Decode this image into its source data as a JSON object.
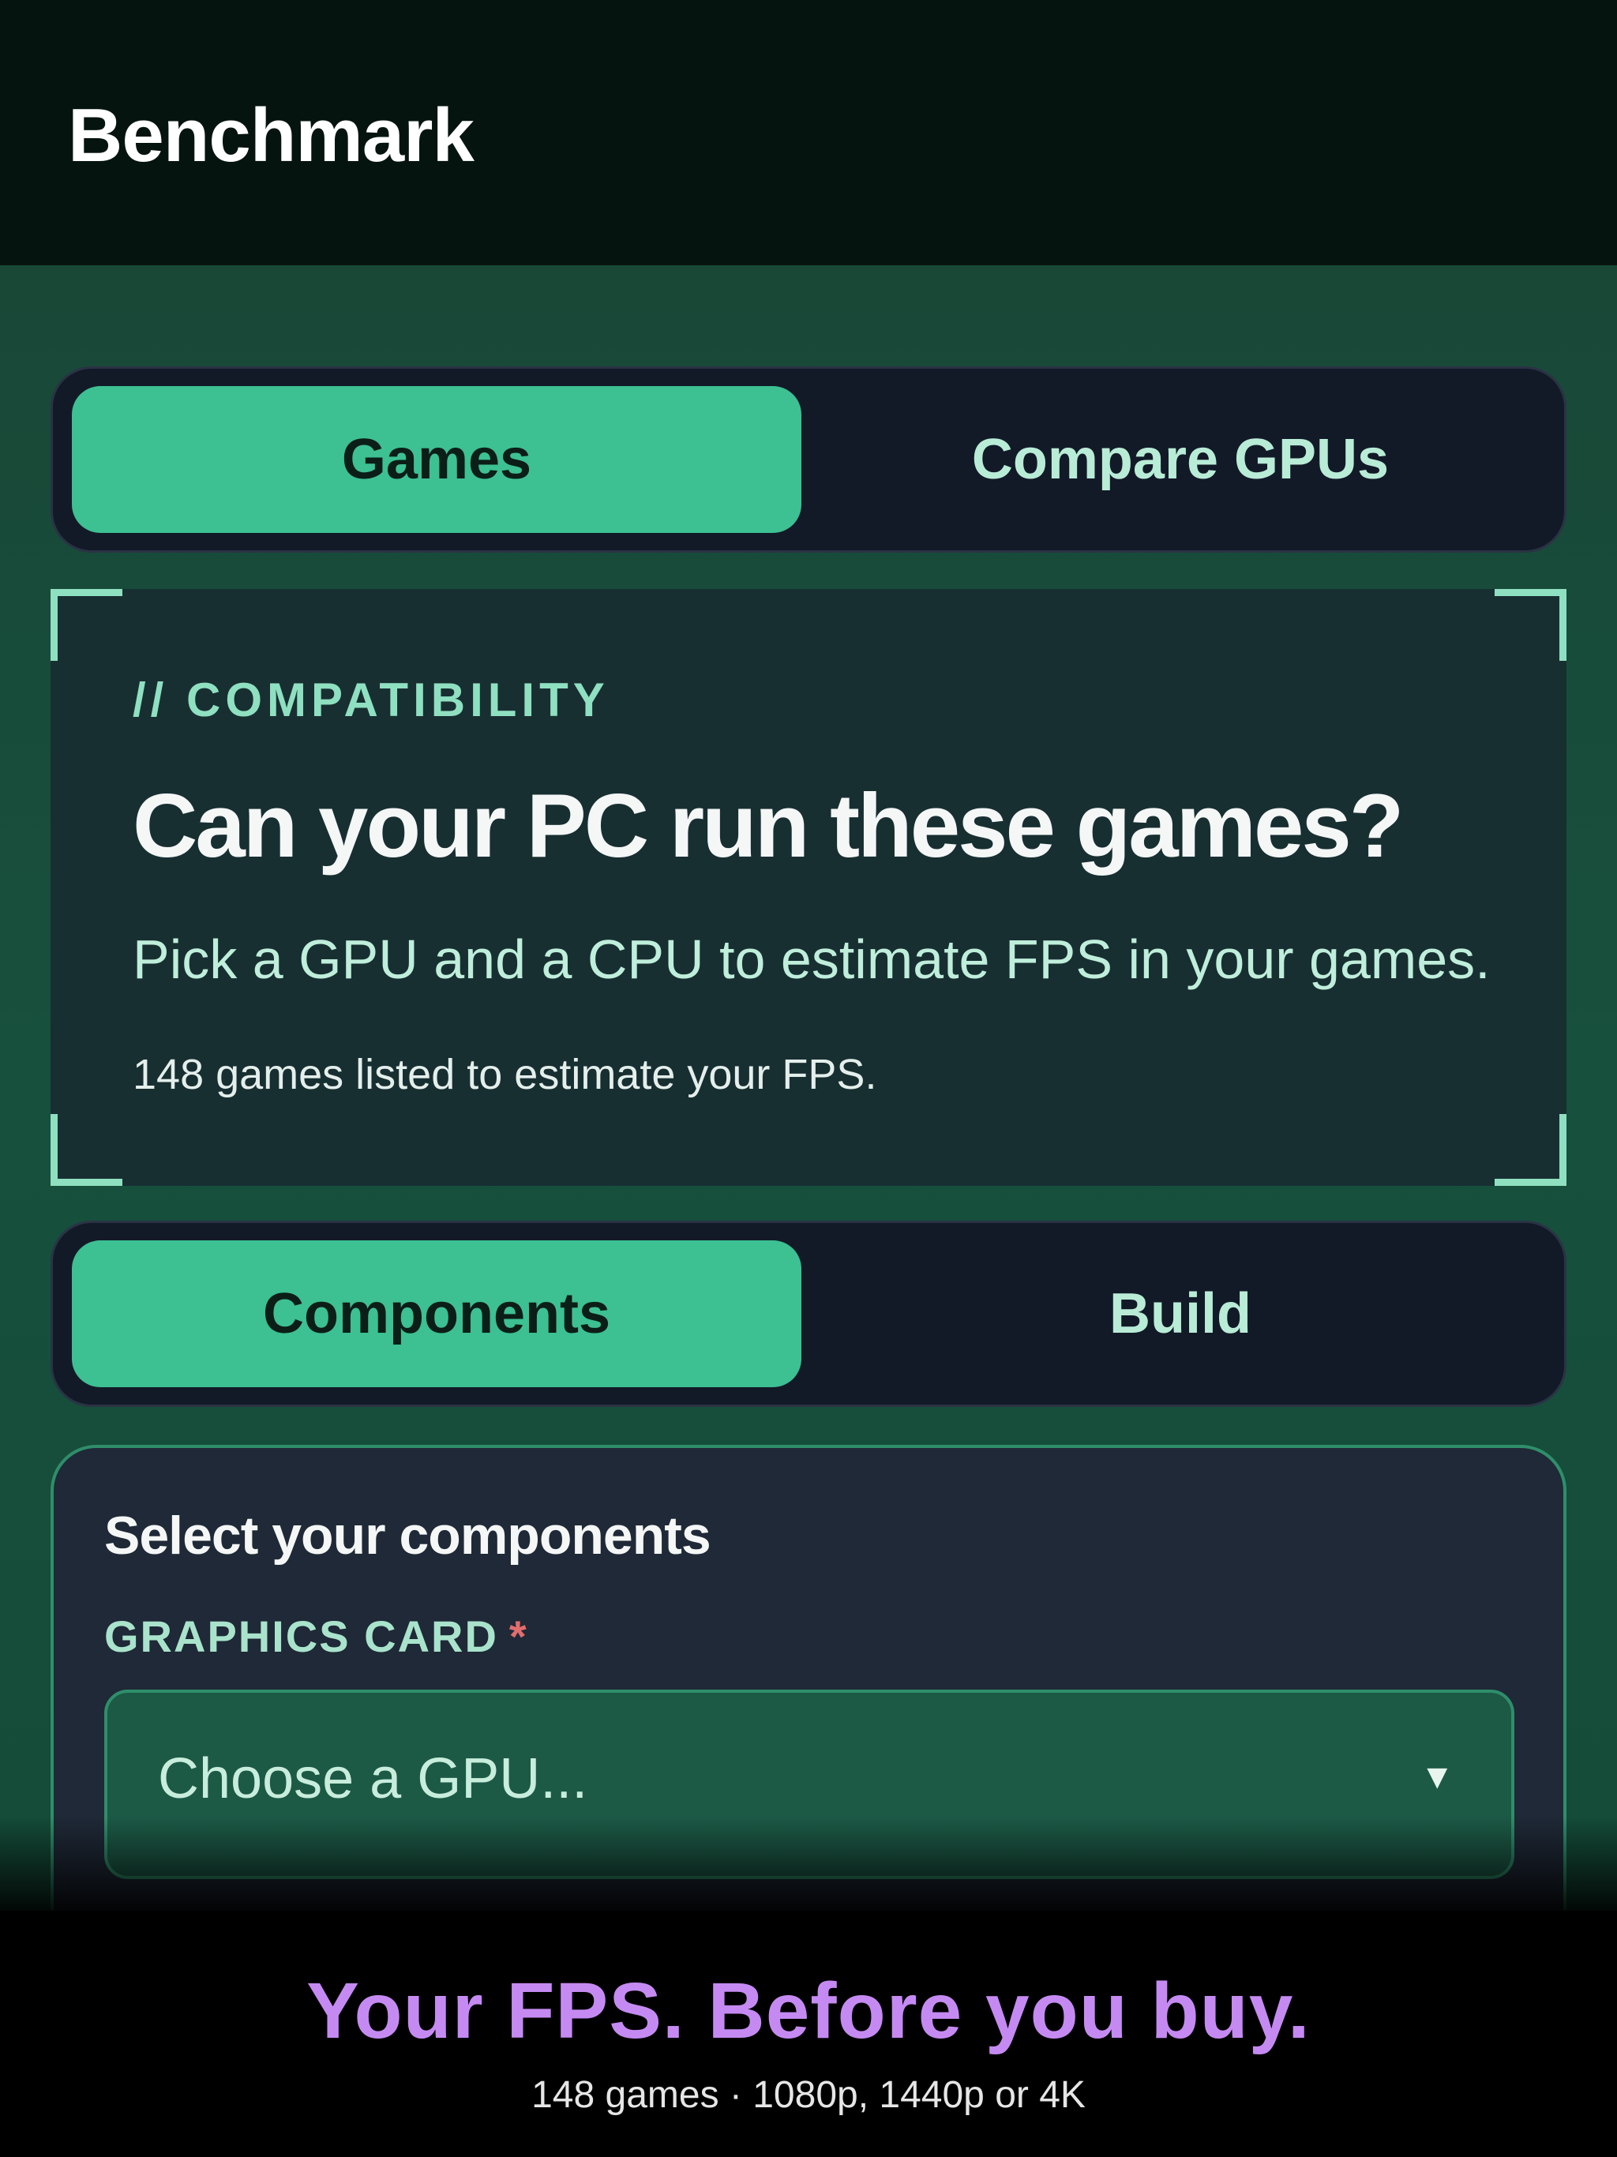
{
  "header": {
    "title": "Benchmark"
  },
  "mode_tabs": [
    {
      "label": "Games",
      "active": true
    },
    {
      "label": "Compare GPUs",
      "active": false
    }
  ],
  "hero": {
    "eyebrow": "// COMPATIBILITY",
    "title": "Can your PC run these games?",
    "subtitle": "Pick a GPU and a CPU to estimate FPS in your games.",
    "count_text": "148 games listed to estimate your FPS."
  },
  "input_tabs": [
    {
      "label": "Components",
      "active": true
    },
    {
      "label": "Build",
      "active": false
    }
  ],
  "components_panel": {
    "title": "Select your components",
    "gpu_label": "GRAPHICS CARD",
    "required_mark": "*",
    "gpu_placeholder": "Choose a GPU...",
    "caret_icon": "chevron-down-icon"
  },
  "promo": {
    "title": "Your FPS. Before you buy.",
    "subtitle": "148 games · 1080p, 1440p or 4K"
  },
  "colors": {
    "accent": "#3dc092",
    "promo_text": "#c58af2",
    "required": "#e26d6d"
  }
}
